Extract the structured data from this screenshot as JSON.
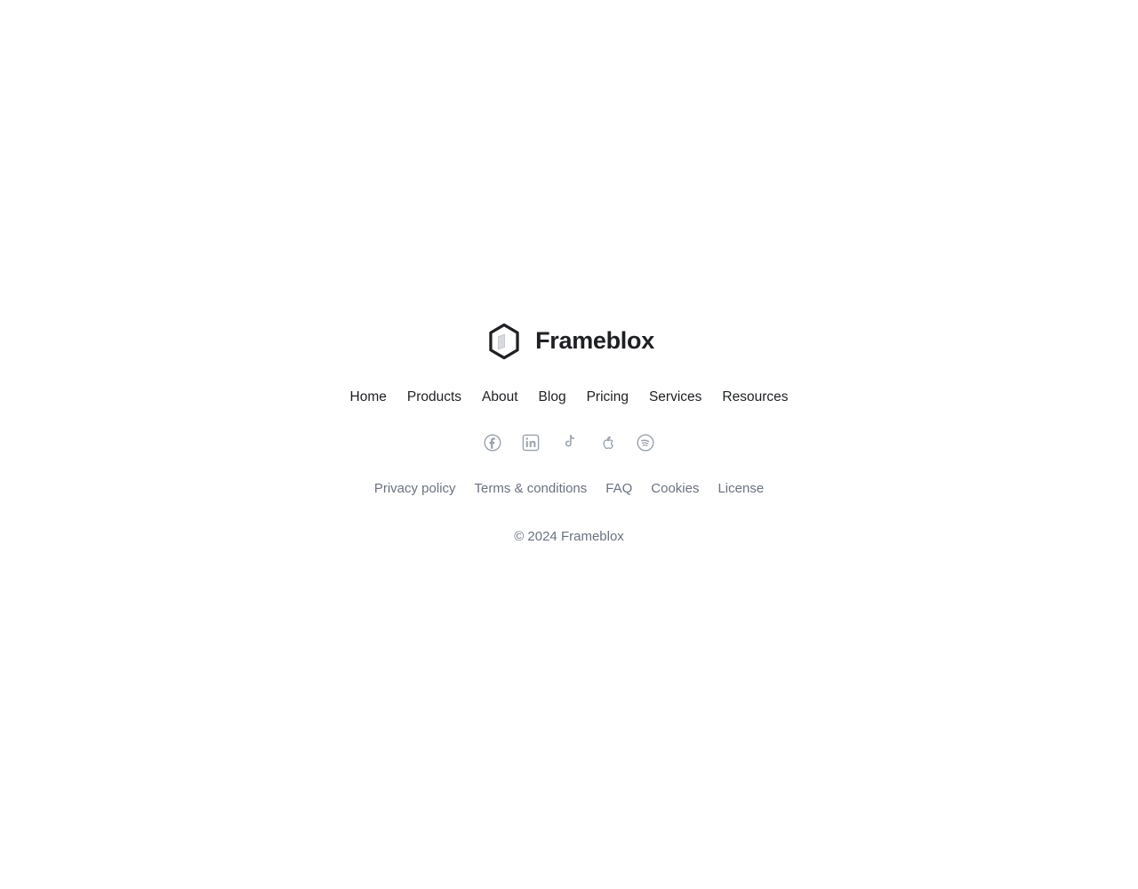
{
  "theme": {
    "background": "#ffffff",
    "text_primary": "#1f2023",
    "text_muted": "#6b7280",
    "icon_color": "#9aa1ab",
    "logo_stroke": "#1f2023",
    "logo_cube_fill": "#d8dade"
  },
  "brand": {
    "name": "Frameblox",
    "logo_icon": "hexagon-cube-logo-icon"
  },
  "nav": {
    "items": [
      {
        "label": "Home"
      },
      {
        "label": "Products"
      },
      {
        "label": "About"
      },
      {
        "label": "Blog"
      },
      {
        "label": "Pricing"
      },
      {
        "label": "Services"
      },
      {
        "label": "Resources"
      }
    ]
  },
  "social": {
    "items": [
      {
        "icon": "facebook-icon",
        "label": "Facebook"
      },
      {
        "icon": "linkedin-icon",
        "label": "LinkedIn"
      },
      {
        "icon": "tiktok-icon",
        "label": "TikTok"
      },
      {
        "icon": "apple-icon",
        "label": "Apple"
      },
      {
        "icon": "spotify-icon",
        "label": "Spotify"
      }
    ]
  },
  "legal": {
    "items": [
      {
        "label": "Privacy policy"
      },
      {
        "label": "Terms & conditions"
      },
      {
        "label": "FAQ"
      },
      {
        "label": "Cookies"
      },
      {
        "label": "License"
      }
    ]
  },
  "copyright": {
    "text": "© 2024 Frameblox"
  }
}
